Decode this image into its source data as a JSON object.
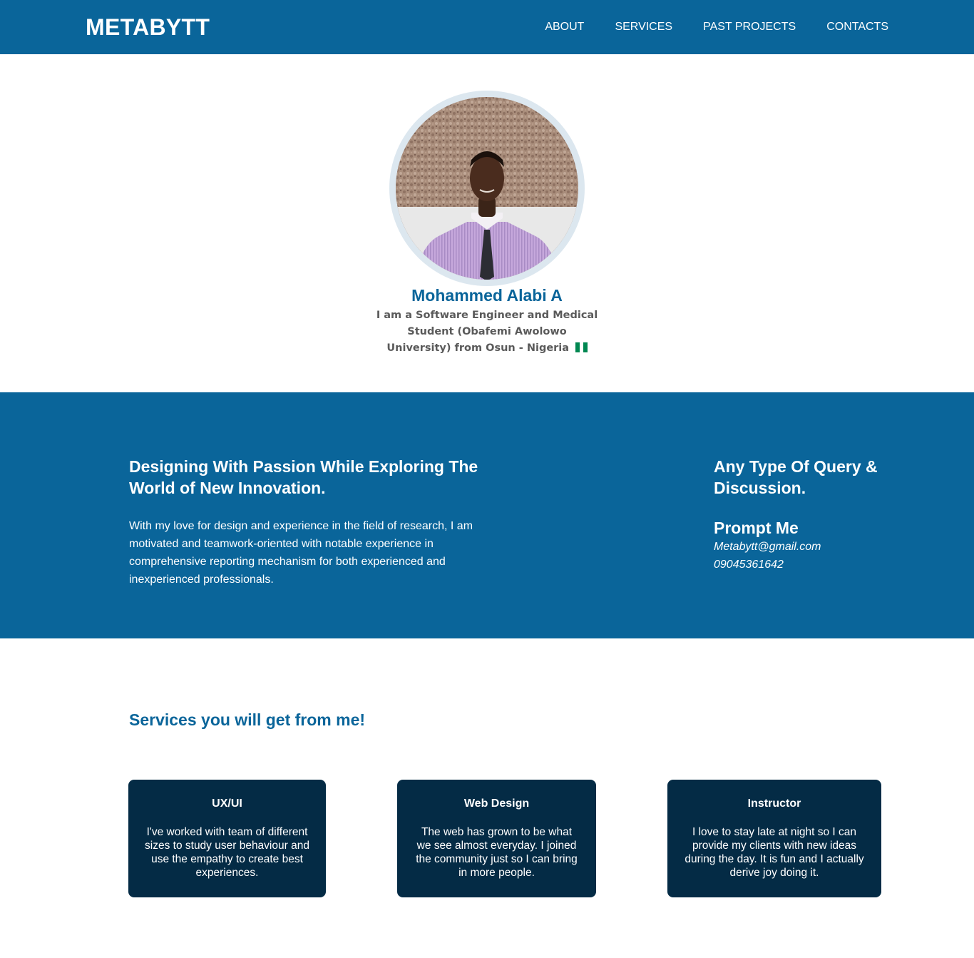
{
  "nav": {
    "brand": "METABYTT",
    "links": [
      "ABOUT",
      "SERVICES",
      "PAST PROJECTS",
      "CONTACTS"
    ]
  },
  "hero": {
    "name": "Mohammed Alabi A",
    "bio": "I am a Software Engineer and Medical Student (Obafemi Awolowo University) from Osun - Nigeria",
    "flag_icon": "nigeria-flag-icon"
  },
  "about": {
    "title": "Designing With Passion While Exploring The World of New Innovation.",
    "text": "With my love for design and experience in the field of research, I am motivated and teamwork-oriented with notable experience in comprehensive reporting mechanism for both experienced and inexperienced professionals.",
    "query_title": "Any Type Of Query & Discussion.",
    "prompt_title": "Prompt Me",
    "email": "Metabytt@gmail.com",
    "phone": "09045361642"
  },
  "services": {
    "title": "Services you will get from me!",
    "cards": [
      {
        "title": "UX/UI",
        "text": "I've worked with team of different sizes to study user behaviour and use the empathy to create best experiences."
      },
      {
        "title": "Web Design",
        "text": "The web has grown to be what we see almost everyday. I joined the community just so I can bring in more people."
      },
      {
        "title": "Instructor",
        "text": "I love to stay late at night so I can provide my clients with new ideas during the day. It is fun and I actually derive joy doing it."
      }
    ]
  },
  "colors": {
    "primary": "#0a659a",
    "card_bg": "#042b45",
    "ring": "#dce7ef",
    "flag_green": "#008751"
  }
}
